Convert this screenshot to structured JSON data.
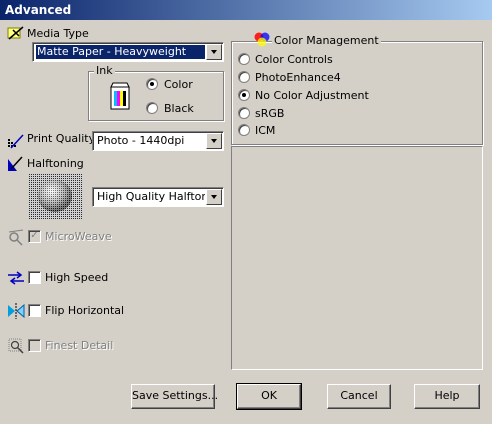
{
  "window": {
    "title": "Advanced"
  },
  "media_type": {
    "label": "Media Type",
    "value": "Matte Paper - Heavyweight"
  },
  "ink": {
    "label": "Ink",
    "options": [
      {
        "label": "Color",
        "selected": true
      },
      {
        "label": "Black",
        "selected": false
      }
    ]
  },
  "print_quality": {
    "label": "Print Quality",
    "value": "Photo - 1440dpi"
  },
  "halftoning": {
    "label": "Halftoning",
    "value": "High Quality Halftoning"
  },
  "options": {
    "microweave": {
      "label": "MicroWeave",
      "checked": true,
      "enabled": false
    },
    "high_speed": {
      "label": "High Speed",
      "checked": false,
      "enabled": true
    },
    "flip_horizontal": {
      "label": "Flip Horizontal",
      "checked": false,
      "enabled": true
    },
    "finest_detail": {
      "label": "Finest Detail",
      "checked": false,
      "enabled": false
    }
  },
  "color_management": {
    "label": "Color Management",
    "options": [
      {
        "label": "Color Controls",
        "selected": false
      },
      {
        "label": "PhotoEnhance4",
        "selected": false
      },
      {
        "label": "No Color Adjustment",
        "selected": true
      },
      {
        "label": "sRGB",
        "selected": false
      },
      {
        "label": "ICM",
        "selected": false
      }
    ]
  },
  "buttons": {
    "save_settings": "Save Settings...",
    "ok": "OK",
    "cancel": "Cancel",
    "help": "Help"
  },
  "icons": {
    "media_type": "media-type-icon",
    "ink_cartridge": "ink-cartridge-icon",
    "print_quality": "print-quality-icon",
    "halftoning": "halftoning-icon",
    "halftone_preview": "halftone-preview-image",
    "microweave": "microweave-icon",
    "high_speed": "high-speed-icon",
    "flip_horizontal": "flip-horizontal-icon",
    "finest_detail": "finest-detail-icon",
    "color_management": "color-management-icon"
  },
  "colors": {
    "titlebar": "#0a246a",
    "face": "#d4d0c8"
  }
}
